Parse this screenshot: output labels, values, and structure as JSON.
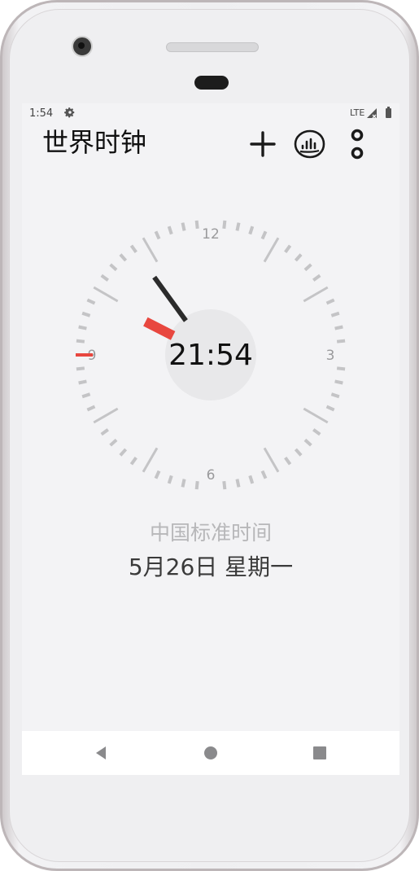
{
  "status_bar": {
    "time": "1:54",
    "network": "LTE",
    "icons": [
      "gear-icon",
      "signal-icon",
      "battery-icon"
    ]
  },
  "app_bar": {
    "title": "世界时钟",
    "actions": [
      "add-icon",
      "compare-icon",
      "more-icon"
    ]
  },
  "clock": {
    "digital_time": "21:54",
    "dial_numbers": {
      "top": "12",
      "right": "3",
      "bottom": "6",
      "left": "9"
    },
    "hour_value": 21,
    "minute_value": 54,
    "second_value": 45
  },
  "timezone": {
    "name": "中国标准时间",
    "date": "5月26日 星期一"
  },
  "nav_bar": {
    "buttons": [
      "back-icon",
      "home-icon",
      "recents-icon"
    ]
  },
  "colors": {
    "accent": "#e8473f",
    "hand": "#2b2b2b",
    "tick": "#c4c4c6",
    "screen_bg": "#f3f3f5"
  }
}
